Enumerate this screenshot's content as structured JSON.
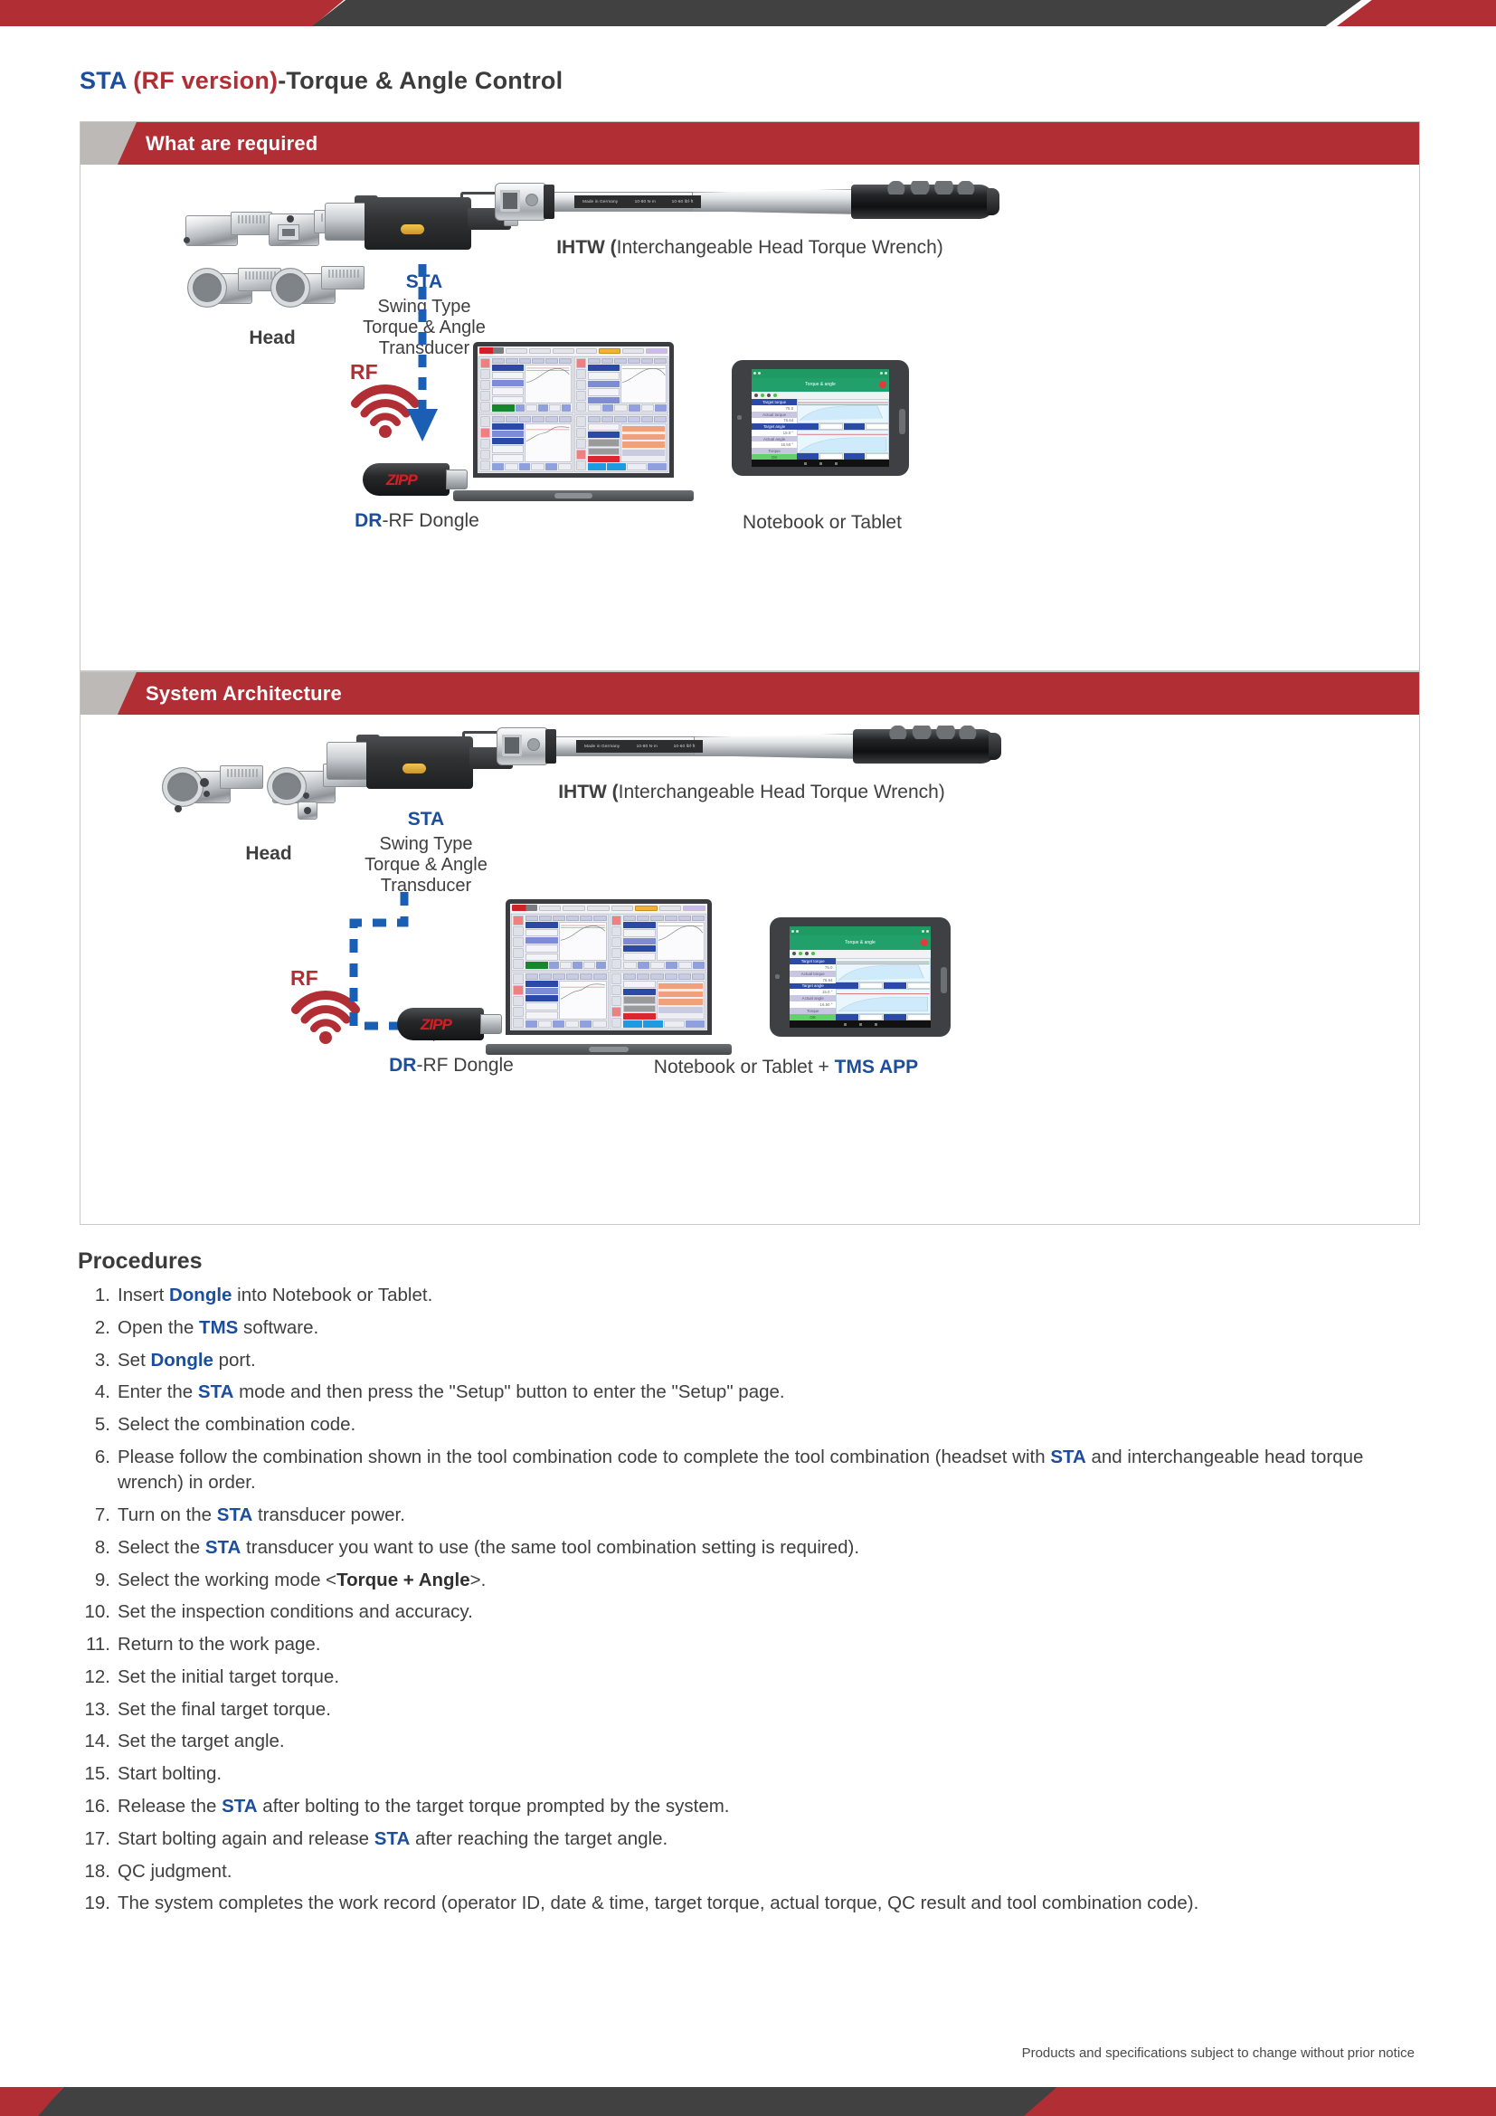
{
  "document": {
    "title_parts": {
      "sta": "STA",
      "rf_version": " (RF version)",
      "rest": "-Torque & Angle Control"
    },
    "footer_note": "Products and specifications subject to change without prior notice"
  },
  "sections": [
    {
      "heading": "What are required",
      "head_label": "Head",
      "sta_label": "STA",
      "sta_desc_line1": "Swing Type",
      "sta_desc_line2": "Torque & Angle",
      "sta_desc_line3": "Transducer",
      "wrench_label_bold": "IHTW (",
      "wrench_label_rest": "Interchangeable Head Torque Wrench)",
      "wrench_plate": [
        "Made in Germany",
        "10-80 N·m",
        "10-60 lbf·ft"
      ],
      "rf_label": "RF",
      "dongle_label_blue": "DR",
      "dongle_label_rest": "-RF Dongle",
      "dongle_logo": "ZIPP",
      "device_label": "Notebook or Tablet"
    },
    {
      "heading": "System Architecture",
      "head_label": "Head",
      "sta_label": "STA",
      "sta_desc_line1": "Swing Type",
      "sta_desc_line2": "Torque & Angle",
      "sta_desc_line3": "Transducer",
      "wrench_label_bold": "IHTW (",
      "wrench_label_rest": "Interchangeable Head Torque Wrench)",
      "wrench_plate": [
        "Made in Germany",
        "10-80 N·m",
        "10-60 lbf·ft"
      ],
      "rf_label": "RF",
      "dongle_label_blue": "DR",
      "dongle_label_rest": "-RF Dongle",
      "dongle_logo": "ZIPP",
      "device_label_plain": "Notebook or Tablet + ",
      "device_label_accent": "TMS APP"
    }
  ],
  "tablet_app": {
    "title": "Torque & angle",
    "rows": [
      {
        "label": "Target torque",
        "value": "75.0"
      },
      {
        "label": "Actual torque",
        "value": "76.64"
      },
      {
        "label": "Target angle",
        "value": "15.0 °"
      },
      {
        "label": "Actual angle",
        "value": "16.50 °"
      },
      {
        "label": "Torque",
        "value": ""
      }
    ],
    "status": "OK",
    "legend": [
      "Actual angle",
      "15.0",
      "Time",
      "0.0"
    ]
  },
  "laptop_app": {
    "quadrants": [
      {
        "target_torque": "100  N·m",
        "actual_torque": "98.63  N·m",
        "count": "0",
        "status": "OK"
      },
      {
        "target_torque": "78  N·m",
        "actual_torque": "68.18  N·m",
        "number": "20"
      },
      {
        "target_torque": "80  N·m",
        "actual_torque": "77.81  N·m",
        "target_angle": "20.50",
        "actual_angle": "15.2",
        "mode": "Torque+..."
      },
      {
        "number": "120",
        "unit": "N·m",
        "tolerance": "40",
        "actual_torque": "60  N·m",
        "static": "0 / 3"
      }
    ]
  },
  "procedures": {
    "title": "Procedures",
    "items": [
      {
        "num": "1.",
        "html": "Insert <b class=\"k\">Dongle</b> into Notebook or Tablet."
      },
      {
        "num": "2.",
        "html": "Open the <b class=\"k\">TMS</b> software."
      },
      {
        "num": "3.",
        "html": "Set <b class=\"k\">Dongle</b> port."
      },
      {
        "num": "4.",
        "html": "Enter the <b class=\"k\">STA</b> mode and then press the \"Setup\" button to enter the \"Setup\" page."
      },
      {
        "num": "5.",
        "html": "Select the combination code."
      },
      {
        "num": "6.",
        "html": "Please follow the combination shown in the tool combination code to complete the tool combination (headset with <b class=\"k\">STA</b> and interchangeable head torque wrench) in order."
      },
      {
        "num": "7.",
        "html": "Turn on the <b class=\"k\">STA</b> transducer power."
      },
      {
        "num": "8.",
        "html": "Select the <b class=\"k\">STA</b> transducer you want to use (the same tool combination setting is required)."
      },
      {
        "num": "9.",
        "html": "Select the working mode &lt;<b class=\"d\">Torque + Angle</b>&gt;."
      },
      {
        "num": "10.",
        "html": "Set the inspection conditions and accuracy."
      },
      {
        "num": "11.",
        "html": "Return to the work page."
      },
      {
        "num": "12.",
        "html": "Set the initial target torque."
      },
      {
        "num": "13.",
        "html": "Set the final target torque."
      },
      {
        "num": "14.",
        "html": "Set the target angle."
      },
      {
        "num": "15.",
        "html": "Start bolting."
      },
      {
        "num": "16.",
        "html": "Release the <b class=\"k\">STA</b> after bolting to the target torque prompted by the system."
      },
      {
        "num": "17.",
        "html": "Start bolting again and release <b class=\"k\">STA</b> after reaching the target angle."
      },
      {
        "num": "18.",
        "html": "QC judgment."
      },
      {
        "num": "19.",
        "html": "The system completes the work record (operator ID, date &amp; time, target torque, actual torque, QC result and tool combination code)."
      }
    ]
  },
  "colors": {
    "brand_red": "#b02e34",
    "brand_dark": "#414141",
    "accent_blue": "#1c4e9c",
    "section_gray": "#bcb9b6",
    "status_green": "#14892c"
  }
}
